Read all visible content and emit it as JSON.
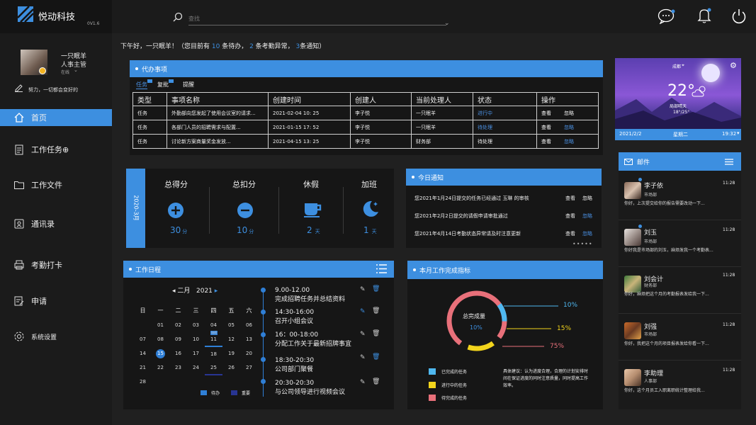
{
  "app": {
    "name": "悦动科技",
    "version": "0V1.6"
  },
  "search": {
    "placeholder": "查找"
  },
  "user": {
    "name": "一只眠羊",
    "role": "人事主管",
    "status": "在线",
    "motto": "努力，一切都会变好的"
  },
  "nav": [
    {
      "label": "首页",
      "icon": "home-icon"
    },
    {
      "label": "工作任务⊕",
      "icon": "task-icon"
    },
    {
      "label": "工作文件",
      "icon": "folder-icon"
    },
    {
      "label": "通讯录",
      "icon": "contacts-icon"
    },
    {
      "label": "考勤打卡",
      "icon": "printer-icon"
    },
    {
      "label": "申请",
      "icon": "apply-icon"
    },
    {
      "label": "系统设置",
      "icon": "gear-icon"
    }
  ],
  "greeting": {
    "p1": "下午好，一只眠羊！（您目前有 ",
    "n1": "10",
    "p2": " 条待办， ",
    "n2": "2",
    "p3": " 条考勤异常， ",
    "n3": "3",
    "p4": "条通知）"
  },
  "todo": {
    "title": "代办事项",
    "tabs": [
      "任务",
      "复批",
      "提醒"
    ],
    "headers": [
      "类型",
      "事项名称",
      "创建时间",
      "创建人",
      "当前处理人",
      "状态",
      "操作"
    ],
    "rows": [
      {
        "type": "任务",
        "name": "外勤部向您发起了使用会议室的请求...",
        "time": "2021-02-04  10: 25",
        "creator": "李子悦",
        "handler": "一只眠羊",
        "status": "进行中",
        "view": "查看",
        "ignore": "忽略"
      },
      {
        "type": "任务",
        "name": "各部门人员的招聘需求与配置...",
        "time": "2021-01-15  17: 52",
        "creator": "李子悦",
        "handler": "一只眠羊",
        "status": "待处理",
        "view": "查看",
        "ignore": "忽略"
      },
      {
        "type": "任务",
        "name": "讨论新方案商量奖金发放...",
        "time": "2021-04-15  13: 25",
        "creator": "李子悦",
        "handler": "财务部",
        "status": "待处理",
        "view": "查看",
        "ignore": "忽略"
      }
    ]
  },
  "stats": {
    "month": "2020-3月",
    "items": [
      {
        "label": "总得分",
        "value": "30",
        "unit": "分",
        "icon": "plus-circle-icon"
      },
      {
        "label": "总扣分",
        "value": "10",
        "unit": "分",
        "icon": "minus-circle-icon"
      },
      {
        "label": "休假",
        "value": "2",
        "unit": "天",
        "icon": "coffee-icon"
      },
      {
        "label": "加班",
        "value": "1",
        "unit": "天",
        "icon": "moon-icon"
      }
    ]
  },
  "notice": {
    "title": "今日通知",
    "items": [
      {
        "text": "您2021年1月24日提交的任务已经通过  玉琳 的审核",
        "view": "查看",
        "ignore": "忽略"
      },
      {
        "text": "您2021年2月2日提交的请假申请审批通过",
        "view": "查看",
        "ignore": "忽略"
      },
      {
        "text": "您2021年4月14日考勤状态异常请及时注意更新",
        "view": "查看",
        "ignore": "忽略"
      }
    ]
  },
  "schedule": {
    "title": "工作日程",
    "month": "二月",
    "year": "2021",
    "weekdays": [
      "日",
      "一",
      "二",
      "三",
      "四",
      "五",
      "六"
    ],
    "weeks": [
      [
        "",
        "01",
        "02",
        "03",
        "04",
        "05",
        "06"
      ],
      [
        "07",
        "08",
        "09",
        "10",
        "11",
        "12",
        "13"
      ],
      [
        "14",
        "15",
        "16",
        "17",
        "18",
        "19",
        "20"
      ],
      [
        "21",
        "22",
        "23",
        "24",
        "25",
        "26",
        "27"
      ],
      [
        "28",
        "",
        "",
        "",
        "",
        "",
        ""
      ]
    ],
    "badge": "加班",
    "legend": [
      {
        "label": "待办",
        "color": "#2f7fd6"
      },
      {
        "label": "重要",
        "color": "#283593"
      }
    ],
    "events": [
      {
        "time": "9.00-12.00",
        "text": "完成招聘任务并总结资料"
      },
      {
        "time": "14:30-16:00",
        "text": "召开小组会议"
      },
      {
        "time": "16：00-18:00",
        "text": "分配工作关于最新招牌事宜"
      },
      {
        "time": "18:30-20:30",
        "text": "公司部门聚餐"
      },
      {
        "time": "20:30-20:30",
        "text": "与公司领导进行视频会议"
      }
    ]
  },
  "indicator": {
    "title": "本月工作完成指标",
    "center_label": "总完成量",
    "center_value": "10%",
    "values": [
      {
        "pct": "10%",
        "color": "#4fb8f0"
      },
      {
        "pct": "15%",
        "color": "#f2d41c"
      },
      {
        "pct": "75%",
        "color": "#e8707a"
      }
    ],
    "legend": [
      {
        "label": "已完成的任务",
        "color": "#4fb8f0"
      },
      {
        "label": "进行中的任务",
        "color": "#f2d41c"
      },
      {
        "label": "待完成的任务",
        "color": "#e8707a"
      }
    ],
    "advice": "具体建议：认为进度合理，合理的计划安排时间在保证进度的同时注意质量，同时提高工作效率。"
  },
  "weather": {
    "city": "成都",
    "temp": "22°",
    "desc": "局部晴天",
    "range": "18°/25°",
    "date": "2021/2/2",
    "weekday": "星期二",
    "time": "19:32"
  },
  "mail": {
    "title": "邮件",
    "items": [
      {
        "name": "李子依",
        "dept": "市场部",
        "time": "11:28",
        "preview": "你好，上次提交给你的报告需要改动一下..."
      },
      {
        "name": "刘玉",
        "dept": "市场部",
        "time": "11:28",
        "preview": "你好我是市场部的刘玉，麻烦发我一个考勤表..."
      },
      {
        "name": "刘会计",
        "dept": "财务部",
        "time": "11:28",
        "preview": "你好，麻烦把这个月的考勤报表发给我一下..."
      },
      {
        "name": "刘强",
        "dept": "市场部",
        "time": "11:28",
        "preview": "你好，我把这个月的项目报表发给你看一下..."
      },
      {
        "name": "李助理",
        "dept": "人事部",
        "time": "11:28",
        "preview": "你好，这个月员工入职离职统计整理给我..."
      }
    ]
  }
}
